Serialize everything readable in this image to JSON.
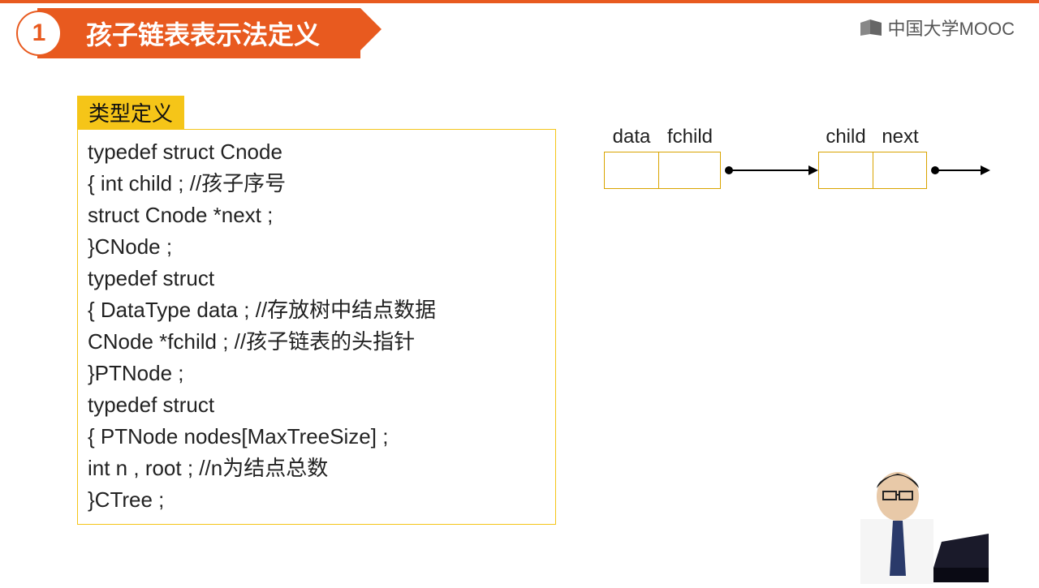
{
  "header": {
    "number": "1",
    "title": "孩子链表表示法定义"
  },
  "logo_text": "中国大学MOOC",
  "type_label": "类型定义",
  "code": {
    "l1": "typedef struct Cnode",
    "l2": "{   int child ;               //孩子序号",
    "l3": "     struct Cnode *next ;",
    "l4": "}CNode ;",
    "l5": "typedef struct",
    "l6": "{   DataType data ; //存放树中结点数据",
    "l7": "     CNode *fchild ; //孩子链表的头指针",
    "l8": "}PTNode ;",
    "l9": "typedef struct",
    "l10": "{   PTNode nodes[MaxTreeSize] ;",
    "l11": "     int  n , root ;     //n为结点总数",
    "l12": "}CTree ;"
  },
  "diagram": {
    "lbl_data": "data",
    "lbl_fchild": "fchild",
    "lbl_child": "child",
    "lbl_next": "next"
  }
}
